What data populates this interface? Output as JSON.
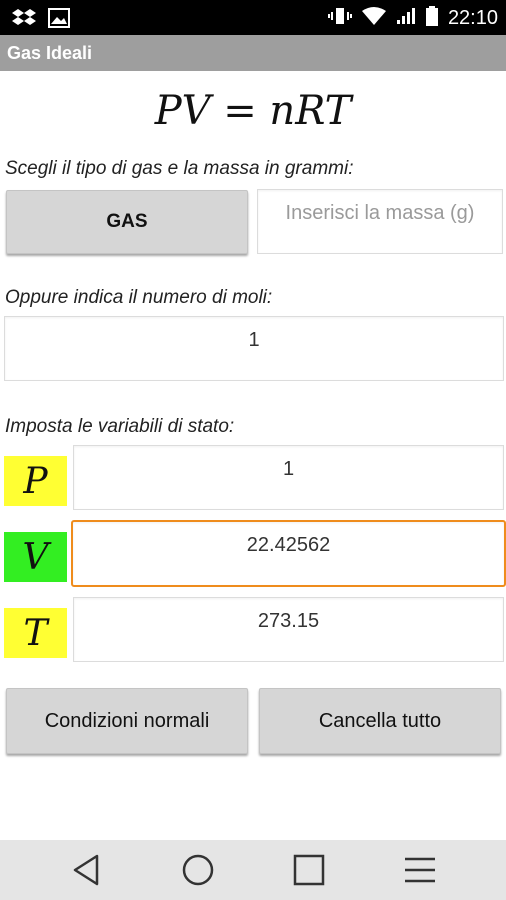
{
  "status_bar": {
    "time": "22:10"
  },
  "app": {
    "title": "Gas Ideali"
  },
  "equation": "PV = nRT",
  "gas_section": {
    "label": "Scegli il tipo di gas e la massa in grammi:",
    "gas_button": "GAS",
    "mass_placeholder": "Inserisci la massa (g)"
  },
  "moles_section": {
    "label": "Oppure indica il numero di moli:",
    "value": "1"
  },
  "state_section": {
    "label": "Imposta le variabili di stato:",
    "variables": [
      {
        "symbol": "P",
        "value": "1",
        "color": "#ffff33"
      },
      {
        "symbol": "V",
        "value": "22.42562",
        "color": "#33ee22"
      },
      {
        "symbol": "T",
        "value": "273.15",
        "color": "#ffff33"
      }
    ]
  },
  "actions": {
    "normal_conditions": "Condizioni normali",
    "clear_all": "Cancella tutto"
  },
  "colors": {
    "focus_border": "#ef8c1c",
    "action_bar": "#9e9e9e"
  },
  "nav_icons": [
    "back-icon",
    "home-icon",
    "recents-icon",
    "menu-icon"
  ]
}
